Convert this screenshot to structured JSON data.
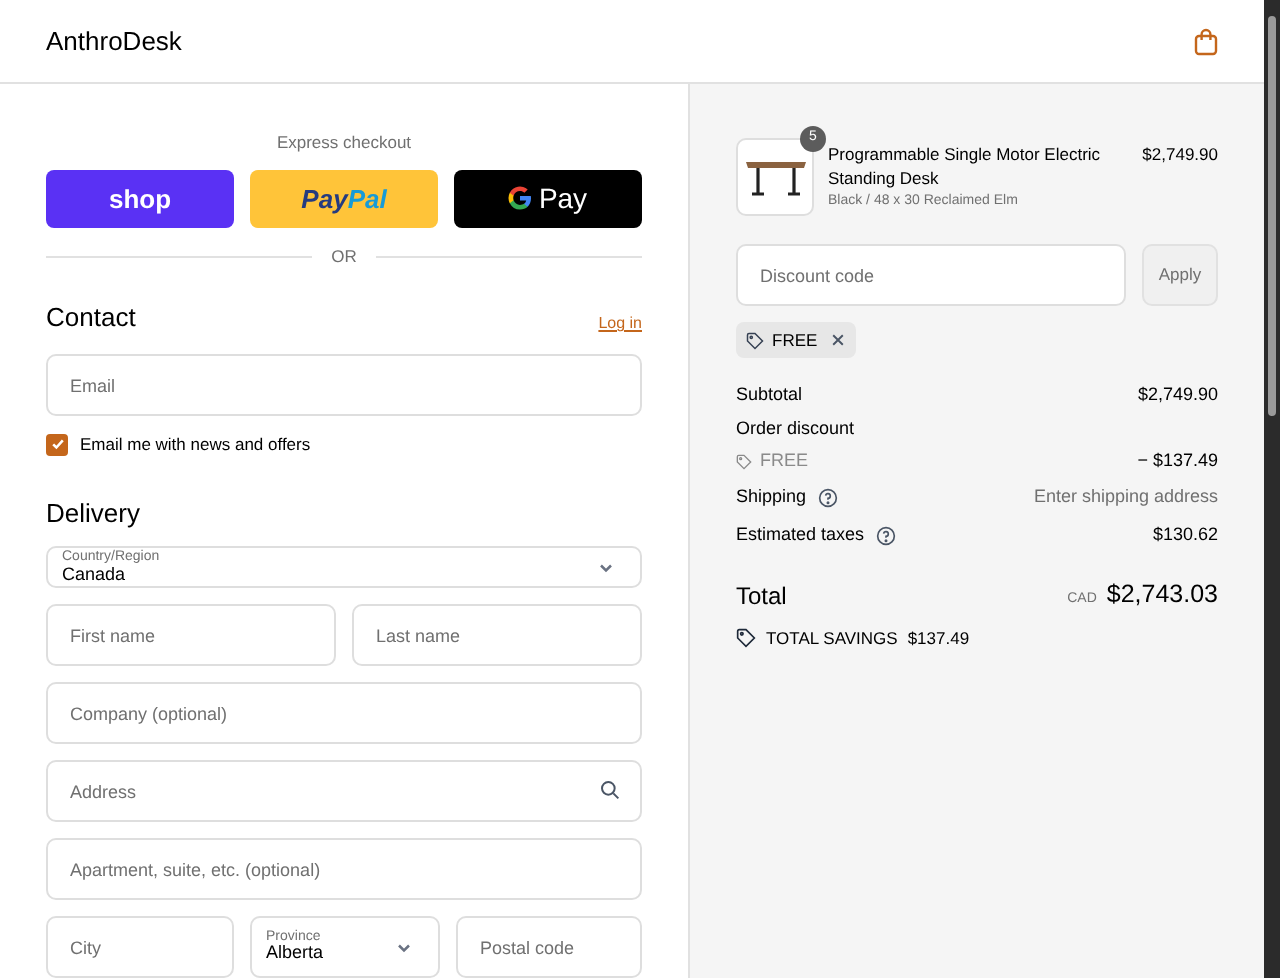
{
  "header": {
    "store_name": "AnthroDesk"
  },
  "express": {
    "title": "Express checkout",
    "buttons": [
      {
        "kind": "shop",
        "label": "shop"
      },
      {
        "kind": "paypal",
        "label_parts": [
          "Pay",
          "Pal"
        ]
      },
      {
        "kind": "gpay",
        "label": "Pay"
      }
    ],
    "divider": "OR"
  },
  "contact": {
    "title": "Contact",
    "login_link": "Log in",
    "email": {
      "placeholder": "Email"
    },
    "newsletter": {
      "label": "Email me with news and offers",
      "checked": true
    }
  },
  "delivery": {
    "title": "Delivery",
    "country": {
      "label": "Country/Region",
      "value": "Canada"
    },
    "first_name": {
      "placeholder": "First name"
    },
    "last_name": {
      "placeholder": "Last name"
    },
    "company": {
      "placeholder": "Company (optional)"
    },
    "address": {
      "placeholder": "Address"
    },
    "apartment": {
      "placeholder": "Apartment, suite, etc. (optional)"
    },
    "city": {
      "placeholder": "City"
    },
    "province": {
      "label": "Province",
      "value": "Alberta"
    },
    "postal": {
      "placeholder": "Postal code"
    }
  },
  "summary": {
    "item": {
      "quantity": "5",
      "name": "Programmable Single Motor Electric Standing Desk",
      "variant": "Black / 48 x 30 Reclaimed Elm",
      "price": "$2,749.90"
    },
    "discount": {
      "placeholder": "Discount code",
      "apply": "Apply",
      "tag": "FREE"
    },
    "subtotal": {
      "label": "Subtotal",
      "value": "$2,749.90"
    },
    "order_discount": {
      "label": "Order discount",
      "code": "FREE",
      "value": "− $137.49"
    },
    "shipping": {
      "label": "Shipping",
      "value": "Enter shipping address"
    },
    "taxes": {
      "label": "Estimated taxes",
      "value": "$130.62"
    },
    "total": {
      "label": "Total",
      "currency": "CAD",
      "value": "$2,743.03"
    },
    "savings": {
      "label": "TOTAL SAVINGS",
      "value": "$137.49"
    }
  }
}
